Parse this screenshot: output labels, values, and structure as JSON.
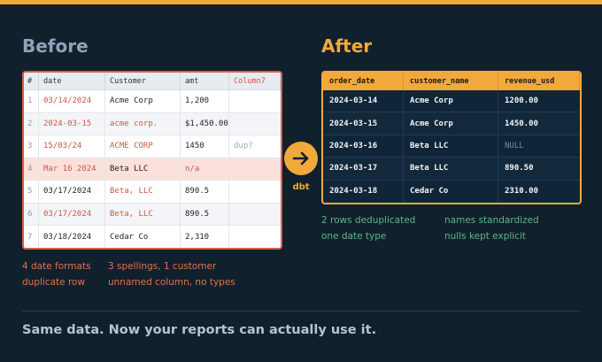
{
  "before": {
    "title": "Before",
    "columns": [
      "#",
      "date",
      "Customer",
      "amt",
      "Column7"
    ],
    "rows": [
      {
        "n": "1",
        "date": "03/14/2024",
        "customer": "Acme Corp",
        "amt": "1,200",
        "extra": ""
      },
      {
        "n": "2",
        "date": "2024-03-15",
        "customer": "acme corp.",
        "amt": "$1,450.00",
        "extra": ""
      },
      {
        "n": "3",
        "date": "15/03/24",
        "customer": "ACME CORP",
        "amt": "1450",
        "extra": "dup?"
      },
      {
        "n": "4",
        "date": "Mar 16 2024",
        "customer": "Beta LLC",
        "amt": "n/a",
        "extra": ""
      },
      {
        "n": "5",
        "date": "03/17/2024",
        "customer": "Beta, LLC",
        "amt": "890.5",
        "extra": ""
      },
      {
        "n": "6",
        "date": "03/17/2024",
        "customer": "Beta, LLC",
        "amt": "890.5",
        "extra": ""
      },
      {
        "n": "7",
        "date": "03/18/2024",
        "customer": "Cedar Co",
        "amt": "2,310",
        "extra": ""
      }
    ],
    "notes": [
      "4 date formats",
      "3 spellings, 1 customer",
      "duplicate row",
      "unnamed column, no types"
    ]
  },
  "transform": {
    "label": "dbt"
  },
  "after": {
    "title": "After",
    "columns": [
      "order_date",
      "customer_name",
      "revenue_usd"
    ],
    "rows": [
      {
        "date": "2024-03-14",
        "customer": "Acme Corp",
        "revenue": "1200.00"
      },
      {
        "date": "2024-03-15",
        "customer": "Acme Corp",
        "revenue": "1450.00"
      },
      {
        "date": "2024-03-16",
        "customer": "Beta LLC",
        "revenue": "NULL"
      },
      {
        "date": "2024-03-17",
        "customer": "Beta LLC",
        "revenue": "890.50"
      },
      {
        "date": "2024-03-18",
        "customer": "Cedar Co",
        "revenue": "2310.00"
      }
    ],
    "notes": [
      "2 rows deduplicated",
      "names standardized",
      "one date type",
      "nulls kept explicit"
    ]
  },
  "tagline": "Same data. Now your reports can actually use it.",
  "colors": {
    "accent": "#f2a93b",
    "error": "#e05a4c",
    "success": "#5fb58a",
    "background": "#10202d"
  },
  "icons": {
    "transform": "arrow-right-icon"
  }
}
